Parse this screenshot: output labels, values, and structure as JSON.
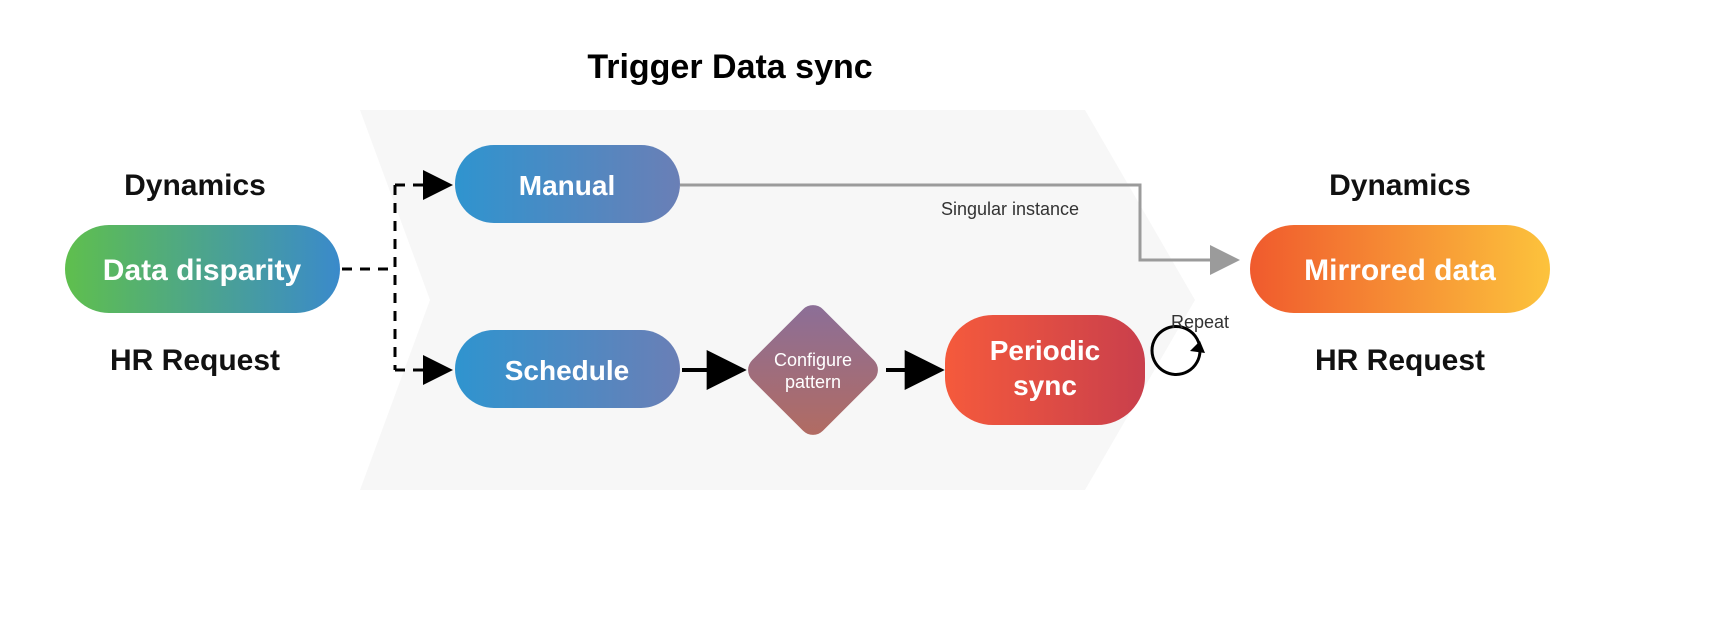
{
  "title": "Trigger Data sync",
  "left": {
    "top_label": "Dynamics",
    "pill": "Data disparity",
    "bottom_label": "HR Request"
  },
  "right": {
    "top_label": "Dynamics",
    "pill": "Mirrored data",
    "bottom_label": "HR Request"
  },
  "nodes": {
    "manual": "Manual",
    "schedule": "Schedule",
    "configure_l1": "Configure",
    "configure_l2": "pattern",
    "periodic_l1": "Periodic",
    "periodic_l2": "sync"
  },
  "labels": {
    "singular": "Singular instance",
    "repeat": "Repeat"
  }
}
